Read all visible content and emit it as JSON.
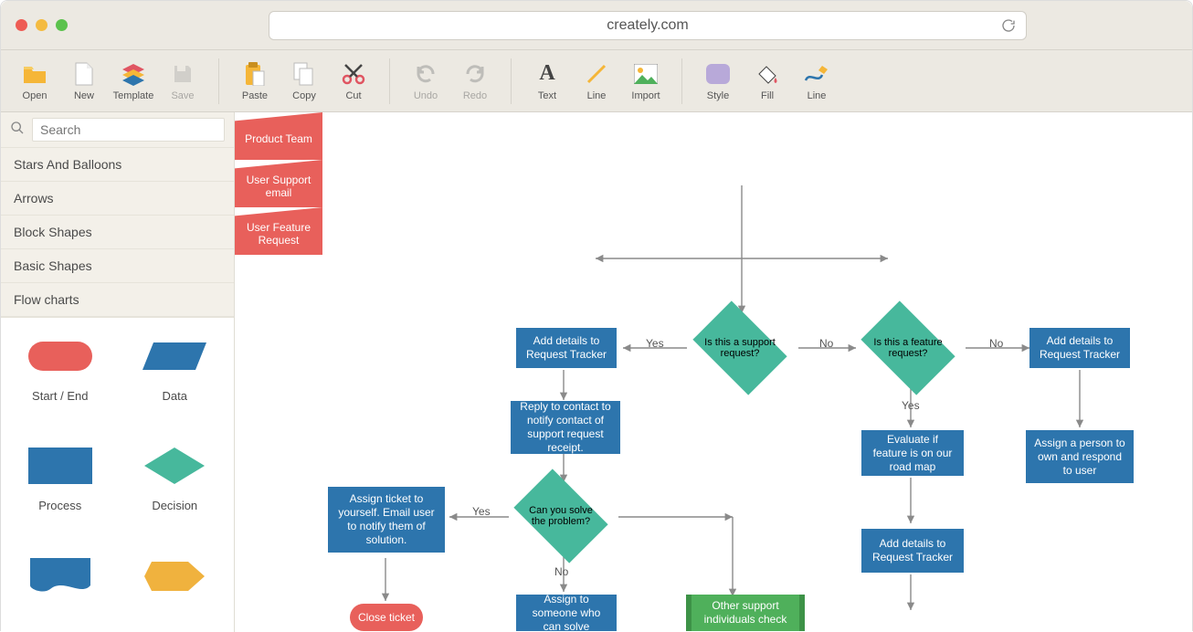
{
  "browser": {
    "url": "creately.com"
  },
  "toolbar": {
    "open": "Open",
    "new": "New",
    "template": "Template",
    "save": "Save",
    "paste": "Paste",
    "copy": "Copy",
    "cut": "Cut",
    "undo": "Undo",
    "redo": "Redo",
    "text": "Text",
    "line": "Line",
    "import": "Import",
    "style": "Style",
    "fill": "Fill",
    "line2": "Line"
  },
  "sidebar": {
    "search_placeholder": "Search",
    "categories": [
      "Stars And Balloons",
      "Arrows",
      "Block Shapes",
      "Basic Shapes",
      "Flow charts"
    ],
    "shapes": {
      "start_end": "Start / End",
      "data": "Data",
      "process": "Process",
      "decision": "Decision"
    }
  },
  "flow": {
    "nodes": {
      "product_team": "Product Team",
      "user_support_email": "User Support email",
      "user_feature_request": "User Feature Request",
      "is_support": "Is this a support request?",
      "is_feature": "Is this a feature request?",
      "add_details_left": "Add details to Request Tracker",
      "add_details_right": "Add details to Request Tracker",
      "reply_contact": "Reply to contact to notify contact of support request receipt.",
      "can_solve": "Can you solve the problem?",
      "assign_ticket": "Assign ticket to yourself. Email user to notify them of solution.",
      "close_ticket": "Close ticket",
      "assign_someone": "Assign to someone who can solve",
      "other_support": "Other support individuals check",
      "evaluate_roadmap": "Evaluate if feature is on our road map",
      "add_details_mid": "Add details to Request Tracker",
      "assign_person": "Assign a person to own and respond to user"
    },
    "labels": {
      "yes": "Yes",
      "no": "No"
    }
  }
}
